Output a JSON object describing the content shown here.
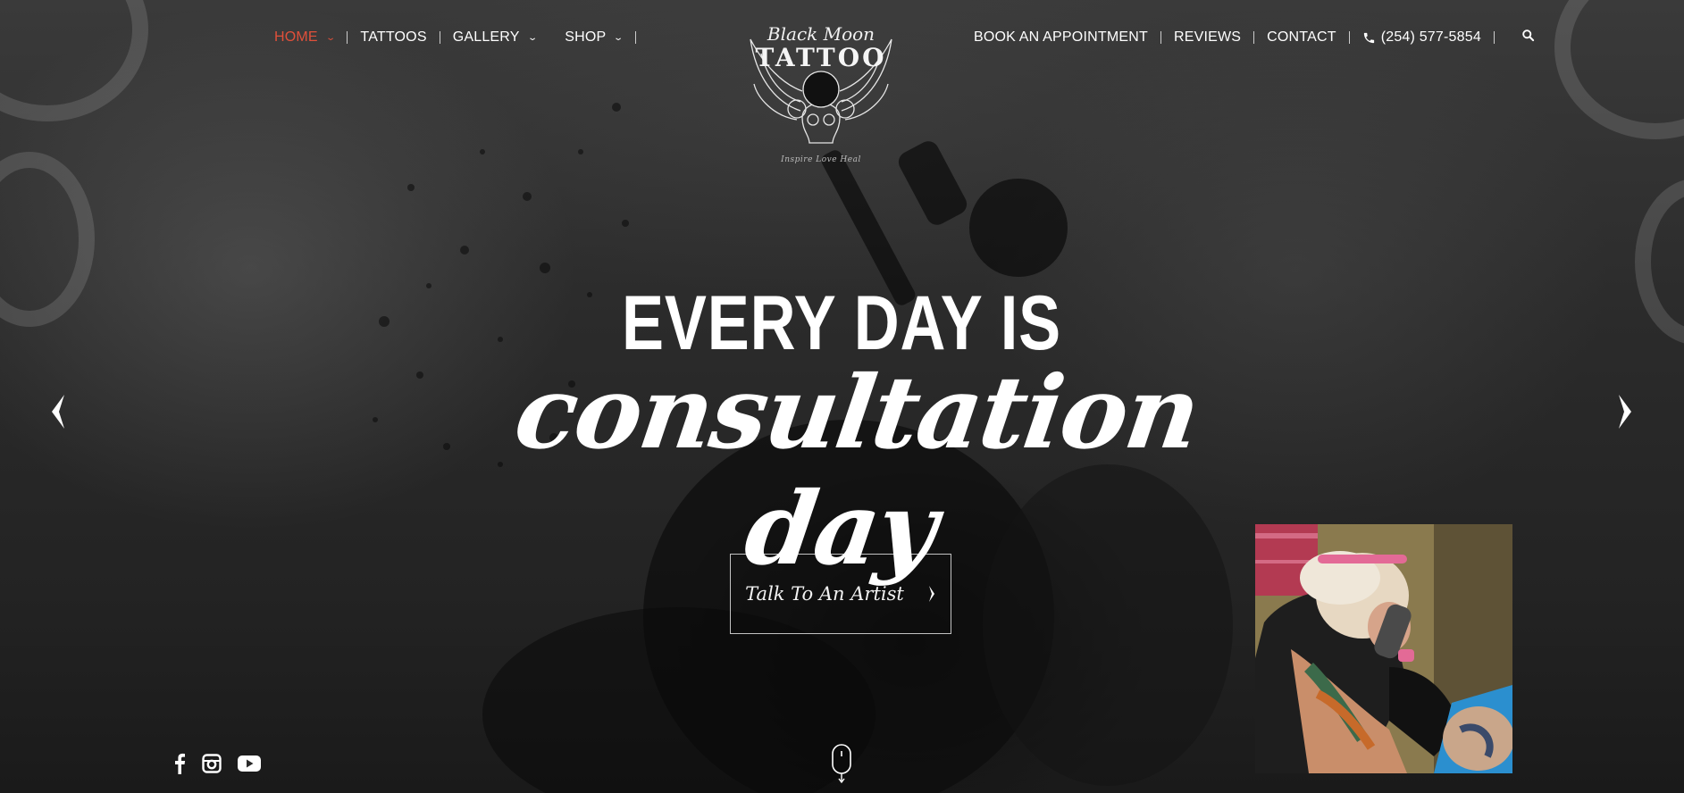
{
  "header": {
    "nav_left": [
      {
        "label": "HOME",
        "has_dropdown": true,
        "active": true
      },
      {
        "label": "TATTOOS",
        "has_dropdown": false
      },
      {
        "label": "GALLERY",
        "has_dropdown": true
      },
      {
        "label": "SHOP",
        "has_dropdown": true
      }
    ],
    "nav_right": [
      {
        "label": "BOOK AN APPOINTMENT"
      },
      {
        "label": "REVIEWS"
      },
      {
        "label": "CONTACT"
      }
    ],
    "phone": "(254) 577-5854",
    "phone_icon": "phone-icon",
    "search_icon": "search-icon",
    "active_color": "#e0503a"
  },
  "logo": {
    "script": "Black Moon",
    "word": "TATTOO",
    "tagline": "Inspire Love Heal"
  },
  "hero": {
    "line1": "EVERY DAY IS",
    "line2": "consultation day",
    "cta_label": "Talk To An Artist",
    "prev_icon": "chevron-left-icon",
    "next_icon": "chevron-right-icon"
  },
  "social": [
    "facebook-icon",
    "instagram-icon",
    "youtube-icon"
  ],
  "scroll_indicator": "mouse-scroll-icon"
}
